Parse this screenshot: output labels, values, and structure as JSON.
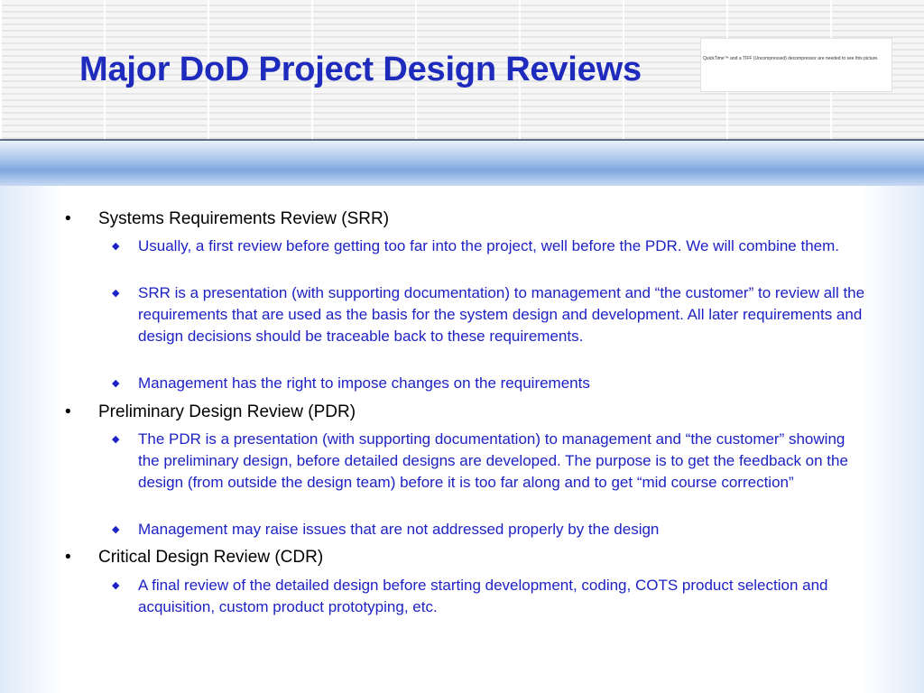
{
  "slide": {
    "title": "Major DoD Project Design Reviews",
    "placeholder_image_text": "QuickTime™ and a TIFF (Uncompressed) decompressor are needed to see this picture."
  },
  "bullets": [
    {
      "text": "Systems Requirements Review (SRR)",
      "subs": [
        "Usually, a first review before getting too far into the project, well before the PDR. We will combine them.",
        "SRR is a presentation (with supporting documentation) to management and “the customer” to review all the requirements that are used as the basis for the system design and development. All later requirements and design decisions should be traceable back to these requirements.",
        "Management has the right to impose changes on the requirements"
      ]
    },
    {
      "text": "Preliminary Design Review (PDR)",
      "subs": [
        "The PDR is a presentation (with supporting documentation) to management and “the customer” showing the preliminary design, before detailed designs are developed. The purpose is to get the feedback on the design (from outside the design team) before it is too far along and to get “mid course correction”",
        "Management may raise issues that are not addressed properly by the design"
      ]
    },
    {
      "text": "Critical Design Review (CDR)",
      "subs": [
        "A final review of the detailed design before starting development, coding, COTS product selection and acquisition, custom product prototyping, etc."
      ]
    }
  ],
  "bullet_symbols": {
    "level1": "•",
    "level2": "◆"
  },
  "colors": {
    "title": "#1f2bbd",
    "sub_text": "#1e22c4",
    "main_text": "#000000"
  }
}
